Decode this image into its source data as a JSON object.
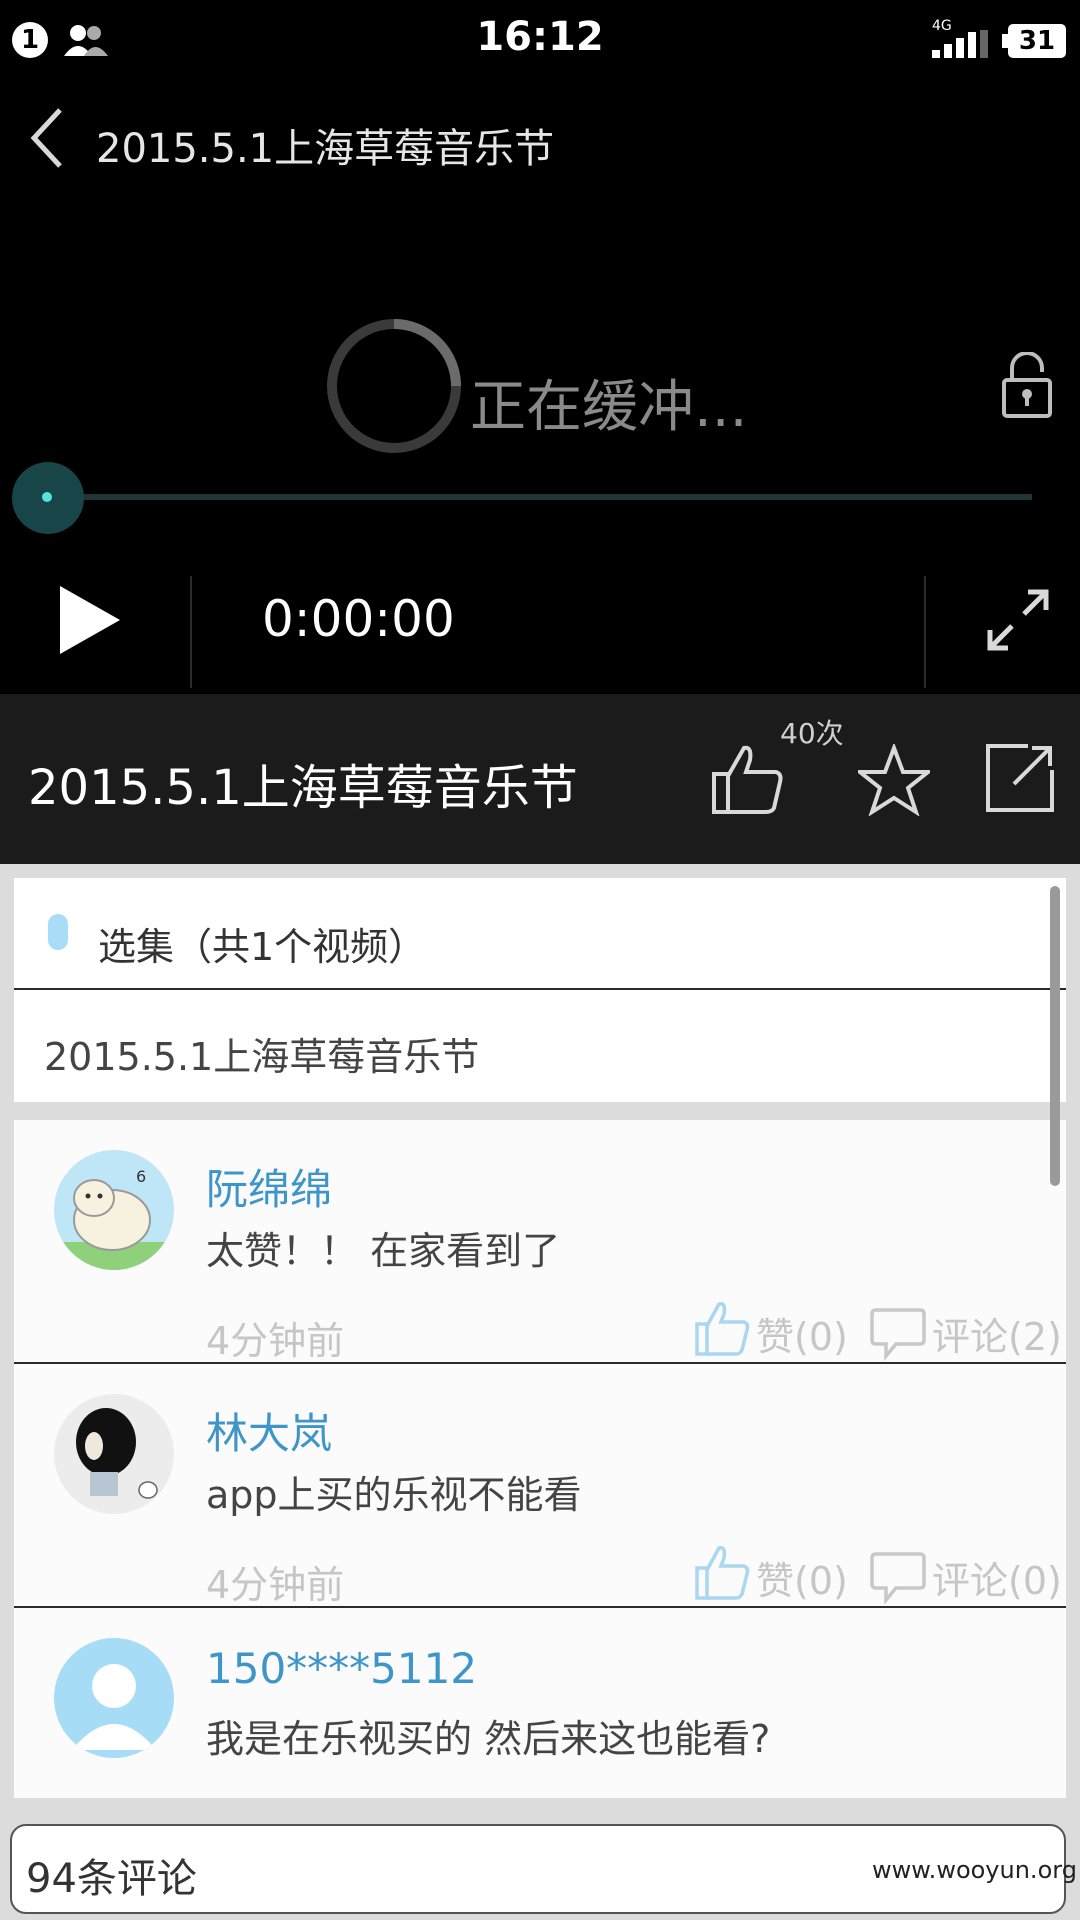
{
  "status_bar": {
    "notification_count": "1",
    "time": "16:12",
    "network": "4G",
    "battery": "31"
  },
  "player": {
    "title": "2015.5.1上海草莓音乐节",
    "buffering_text": "正在缓冲...",
    "current_time": "0:00:00",
    "progress": 0
  },
  "info": {
    "title": "2015.5.1上海草莓音乐节",
    "like_count": "40次"
  },
  "episodes": {
    "header": "选集（共1个视频）",
    "items": [
      "2015.5.1上海草莓音乐节"
    ]
  },
  "comments": [
    {
      "name": "阮绵绵",
      "text": "太赞！！ 在家看到了",
      "time": "4分钟前",
      "likes": "赞(0)",
      "replies": "评论(2)"
    },
    {
      "name": "林大岚",
      "text": "app上买的乐视不能看",
      "time": "4分钟前",
      "likes": "赞(0)",
      "replies": "评论(0)"
    },
    {
      "name": "150****5112",
      "text": "我是在乐视买的  然后来这也能看?",
      "time": "",
      "likes": "",
      "replies": ""
    }
  ],
  "comment_input": {
    "label": "94条评论"
  },
  "watermark": "www.wooyun.org",
  "colors": {
    "accent": "#3d95c9",
    "progress": "#58e2e2"
  }
}
